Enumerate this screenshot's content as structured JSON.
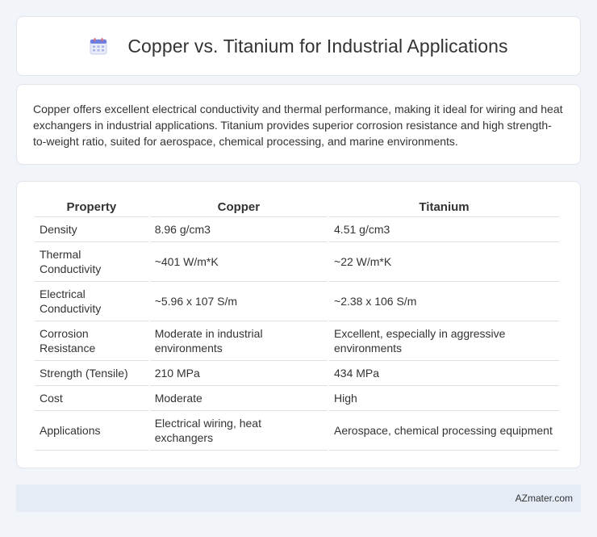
{
  "header": {
    "title": "Copper vs. Titanium for Industrial Applications",
    "icon": "calendar-icon"
  },
  "summary": {
    "text": "Copper offers excellent electrical conductivity and thermal performance, making it ideal for wiring and heat exchangers in industrial applications. Titanium provides superior corrosion resistance and high strength-to-weight ratio, suited for aerospace, chemical processing, and marine environments."
  },
  "table": {
    "headers": [
      "Property",
      "Copper",
      "Titanium"
    ],
    "rows": [
      [
        "Density",
        "8.96 g/cm3",
        "4.51 g/cm3"
      ],
      [
        "Thermal Conductivity",
        "~401 W/m*K",
        "~22 W/m*K"
      ],
      [
        "Electrical Conductivity",
        "~5.96 x 107 S/m",
        "~2.38 x 106 S/m"
      ],
      [
        "Corrosion Resistance",
        "Moderate in industrial environments",
        "Excellent, especially in aggressive environments"
      ],
      [
        "Strength (Tensile)",
        "210 MPa",
        "434 MPa"
      ],
      [
        "Cost",
        "Moderate",
        "High"
      ],
      [
        "Applications",
        "Electrical wiring, heat exchangers",
        "Aerospace, chemical processing equipment"
      ]
    ]
  },
  "footer": {
    "credit": "AZmater.com"
  },
  "colors": {
    "background": "#f1f4f9",
    "card": "#ffffff",
    "footer": "#e6ecf6",
    "text": "#333333"
  }
}
